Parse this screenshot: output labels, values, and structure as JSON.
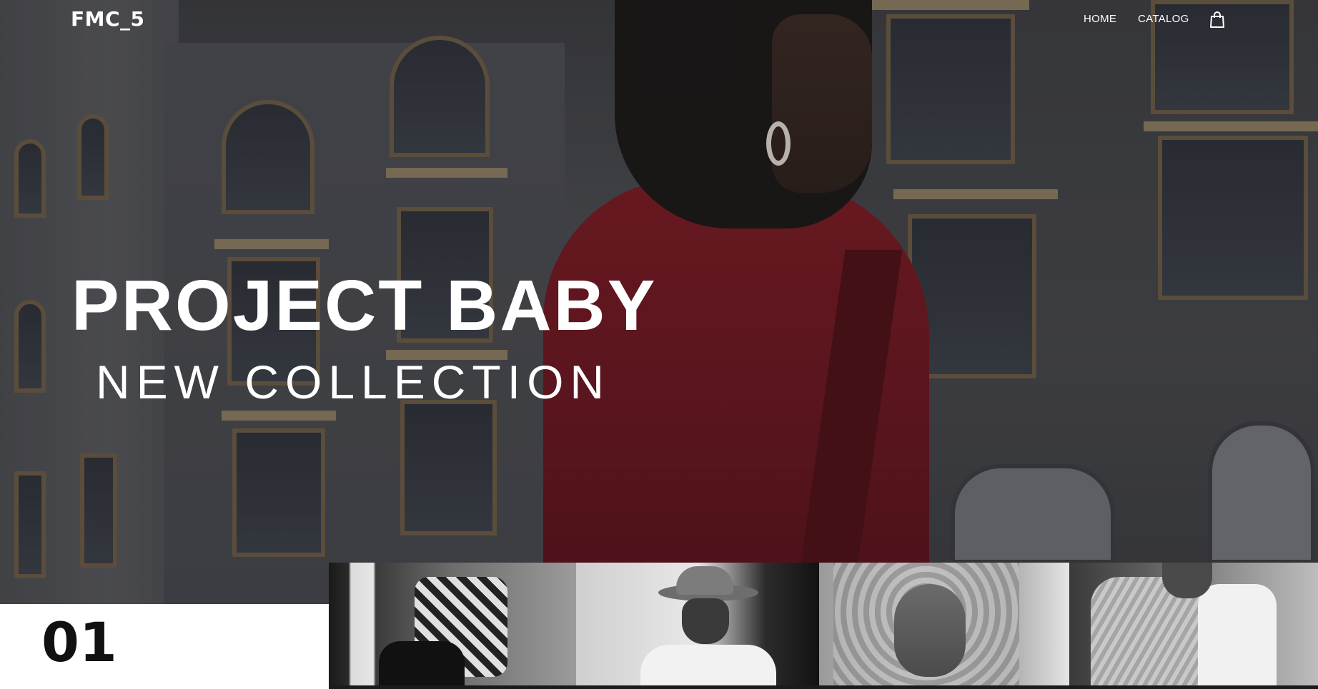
{
  "header": {
    "logo": "FMC_5",
    "nav": [
      {
        "label": "HOME"
      },
      {
        "label": "CATALOG"
      }
    ],
    "cart_icon": "shopping-bag-icon"
  },
  "hero": {
    "title": "PROJECT BABY",
    "subtitle": "NEW COLLECTION"
  },
  "slider": {
    "counter": "01",
    "thumbnails": [
      {
        "name": "woman-plaid-shirt-photo"
      },
      {
        "name": "man-hat-sunglasses-photo"
      },
      {
        "name": "woman-portrait-scarf-photo"
      },
      {
        "name": "woman-denim-jacket-photo"
      }
    ]
  },
  "colors": {
    "jacket_red": "#6b1520",
    "text": "#ffffff",
    "counter_text": "#111111"
  }
}
